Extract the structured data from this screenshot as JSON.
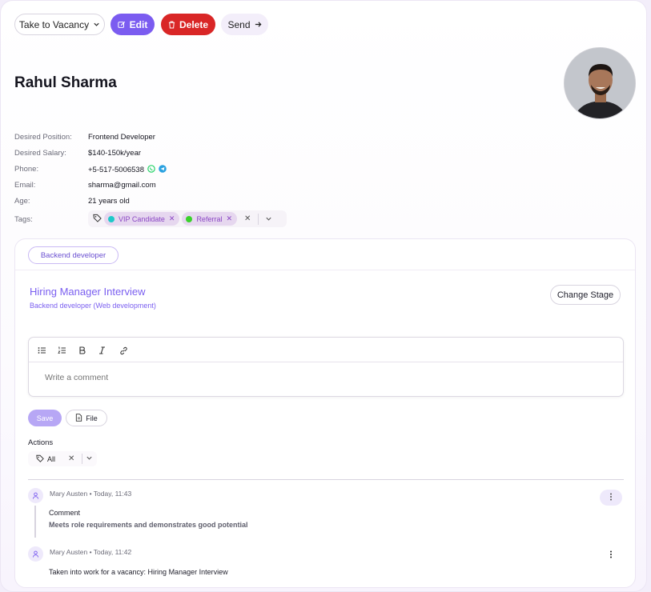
{
  "toolbar": {
    "vacancy_label": "Take to Vacancy",
    "edit_label": "Edit",
    "delete_label": "Delete",
    "send_label": "Send"
  },
  "candidate": {
    "name": "Rahul Sharma",
    "fields": {
      "position_label": "Desired Position:",
      "position": "Frontend Developer",
      "salary_label": "Desired Salary:",
      "salary": "$140-150k/year",
      "phone_label": "Phone:",
      "phone": "+5-517-5006538",
      "email_label": "Email:",
      "email": "sharma@gmail.com",
      "age_label": "Age:",
      "age": "21 years old",
      "tags_label": "Tags:"
    },
    "tags": [
      {
        "label": "VIP Candidate",
        "color": "#1ec9c9"
      },
      {
        "label": "Referral",
        "color": "#3ad12b"
      }
    ]
  },
  "pipeline": {
    "vacancy_pill": "Backend developer",
    "stage_title": "Hiring Manager Interview",
    "stage_subtitle": "Backend developer (Web development)",
    "change_stage_label": "Change Stage",
    "comment_placeholder": "Write a comment",
    "save_label": "Save",
    "file_label": "File",
    "actions_label": "Actions",
    "actions_filter": "All"
  },
  "activity": [
    {
      "author_meta": "Mary Austen • Today, 11:43",
      "type": "Comment",
      "body": "Meets role requirements and demonstrates good potential"
    },
    {
      "author_meta": "Mary Austen • Today, 11:42",
      "text": "Taken into work for a vacancy: Hiring Manager Interview"
    }
  ],
  "colors": {
    "accent": "#7b5cf0",
    "danger": "#d92626",
    "whatsapp": "#25d366",
    "telegram": "#2aa1e0"
  }
}
